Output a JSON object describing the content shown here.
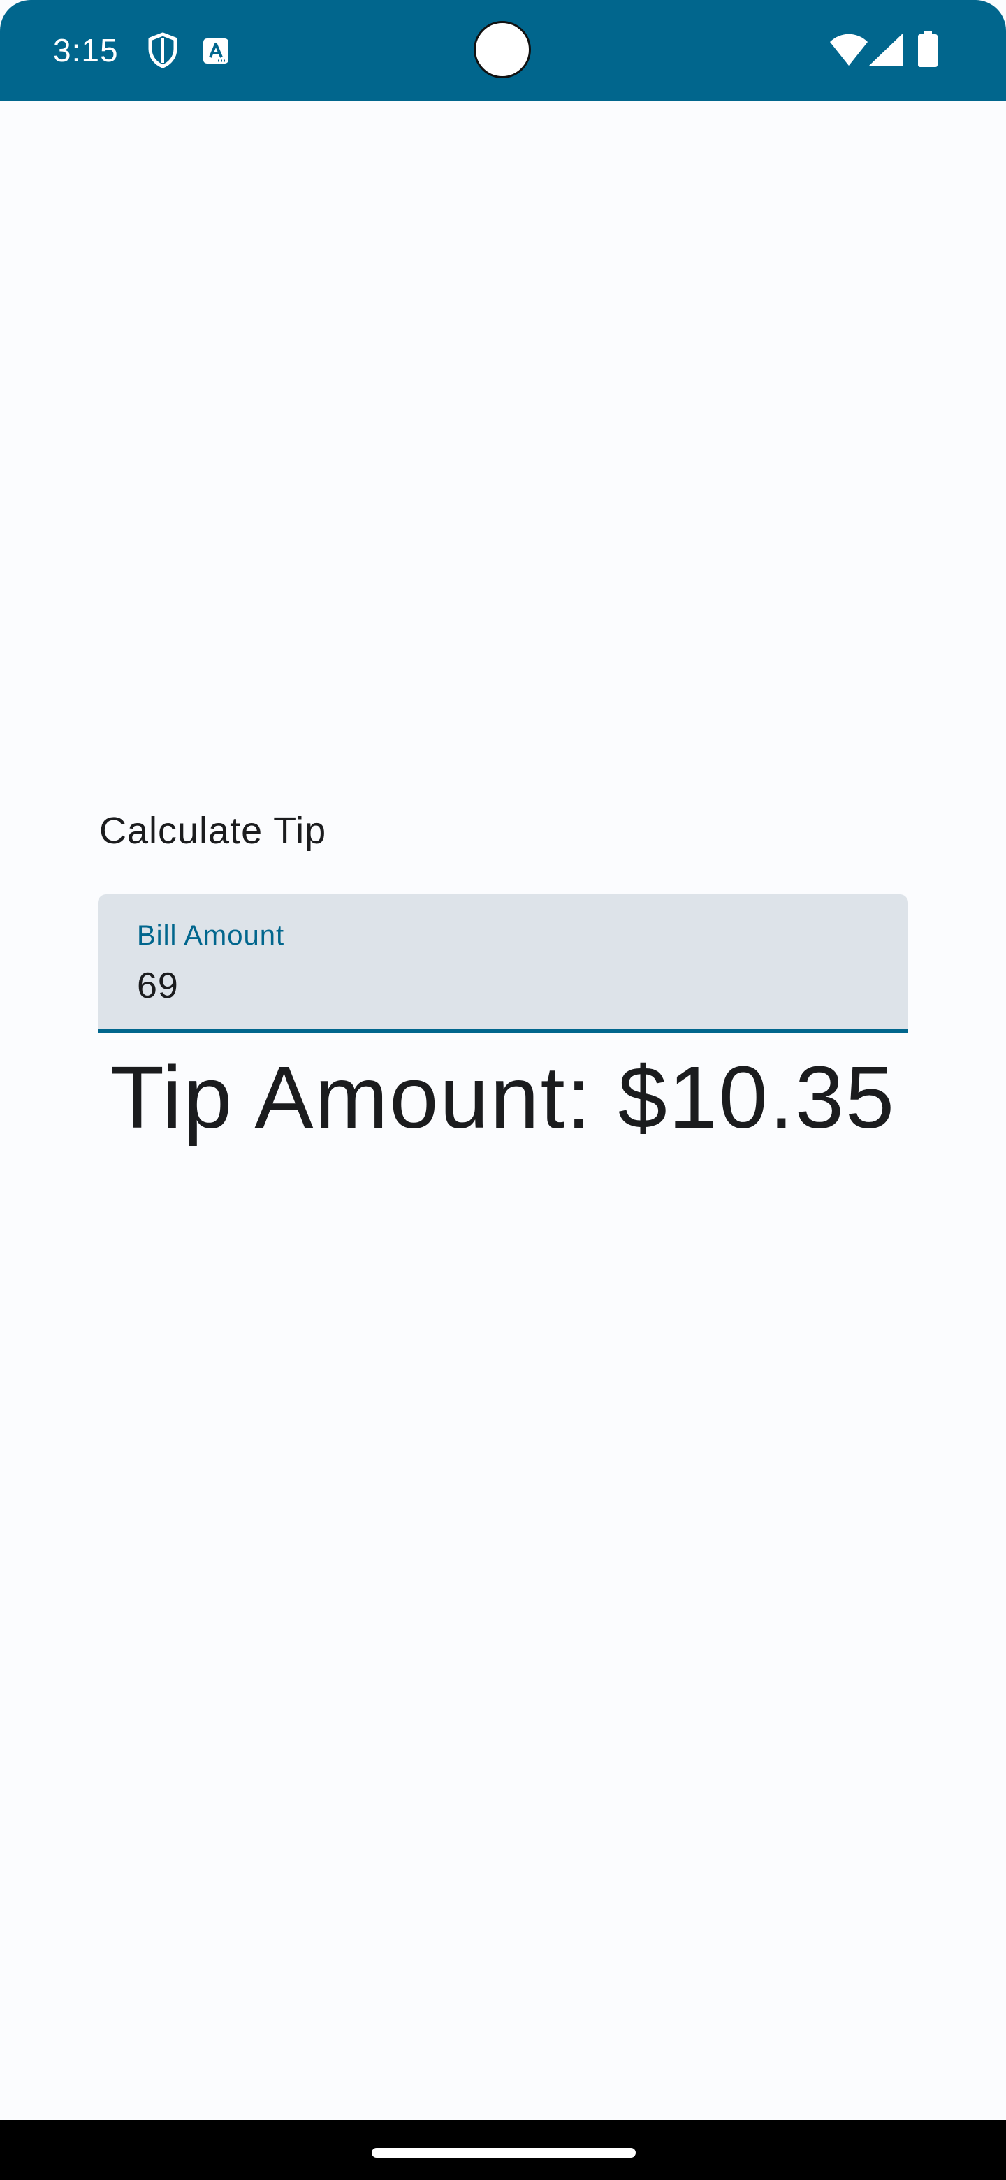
{
  "status_bar": {
    "time": "3:15",
    "icons": [
      "shield-icon",
      "text-a-icon",
      "wifi-icon",
      "signal-icon",
      "battery-icon"
    ],
    "background_color": "#01668d"
  },
  "main": {
    "title": "Calculate Tip",
    "bill_field": {
      "label": "Bill Amount",
      "value": "69"
    },
    "tip_result": "Tip Amount: $10.35"
  },
  "colors": {
    "accent": "#01668d",
    "field_background": "#dde3e9",
    "page_background": "#fbfcfe",
    "text": "#1b1c1e"
  }
}
